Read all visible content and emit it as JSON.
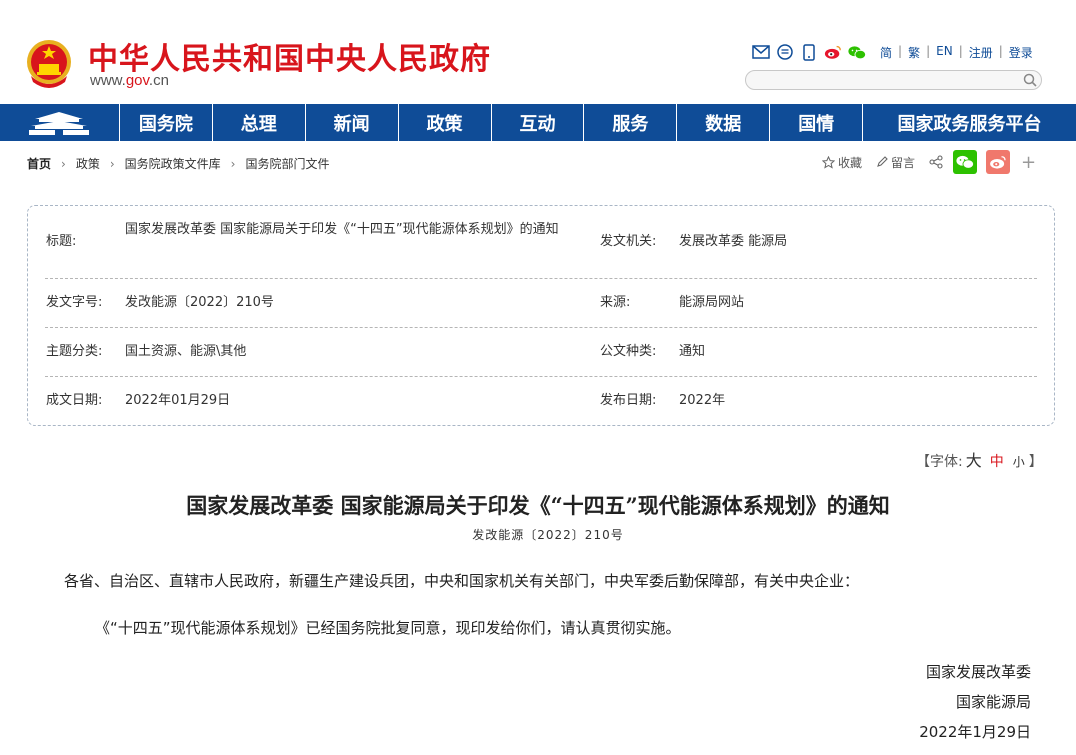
{
  "header": {
    "site_title": "中华人民共和国中央人民政府",
    "site_url_prefix": "www.",
    "site_url_brand": "gov",
    "site_url_suffix": ".cn",
    "links": [
      "简",
      "繁",
      "EN",
      "注册",
      "登录"
    ],
    "search_placeholder": "",
    "icons": [
      "mail-icon",
      "message-icon",
      "mobile-icon",
      "weibo-icon",
      "wechat-icon"
    ]
  },
  "nav": {
    "items": [
      "国务院",
      "总理",
      "新闻",
      "政策",
      "互动",
      "服务",
      "数据",
      "国情",
      "国家政务服务平台"
    ]
  },
  "breadcrumb": [
    "首页",
    "政策",
    "国务院政策文件库",
    "国务院部门文件"
  ],
  "actions": {
    "favorite": "收藏",
    "comment": "留言"
  },
  "info": {
    "title_label": "标题:",
    "title_value": "国家发展改革委 国家能源局关于印发《“十四五”现代能源体系规划》的通知",
    "issuer_label": "发文机关:",
    "issuer_value": "发展改革委 能源局",
    "docno_label": "发文字号:",
    "docno_value": "发改能源〔2022〕210号",
    "source_label": "来源:",
    "source_value": "能源局网站",
    "topic_label": "主题分类:",
    "topic_value": "国土资源、能源\\其他",
    "type_label": "公文种类:",
    "type_value": "通知",
    "written_label": "成文日期:",
    "written_value": "2022年01月29日",
    "published_label": "发布日期:",
    "published_value": "2022年"
  },
  "fontsize": {
    "open": "【字体:",
    "large": "大",
    "medium": "中",
    "small": "小",
    "close": "】"
  },
  "article": {
    "title": "国家发展改革委 国家能源局关于印发《“十四五”现代能源体系规划》的通知",
    "doc_number": "发改能源〔2022〕210号",
    "salutation": "各省、自治区、直辖市人民政府，新疆生产建设兵团，中央和国家机关有关部门，中央军委后勤保障部，有关中央企业：",
    "body": "《“十四五”现代能源体系规划》已经国务院批复同意，现印发给你们，请认真贯彻实施。",
    "signatures": [
      "国家发展改革委",
      "国家能源局"
    ],
    "date": "2022年1月29日"
  },
  "colors": {
    "brand_red": "#d8151c",
    "nav_blue": "#0f4c97"
  }
}
